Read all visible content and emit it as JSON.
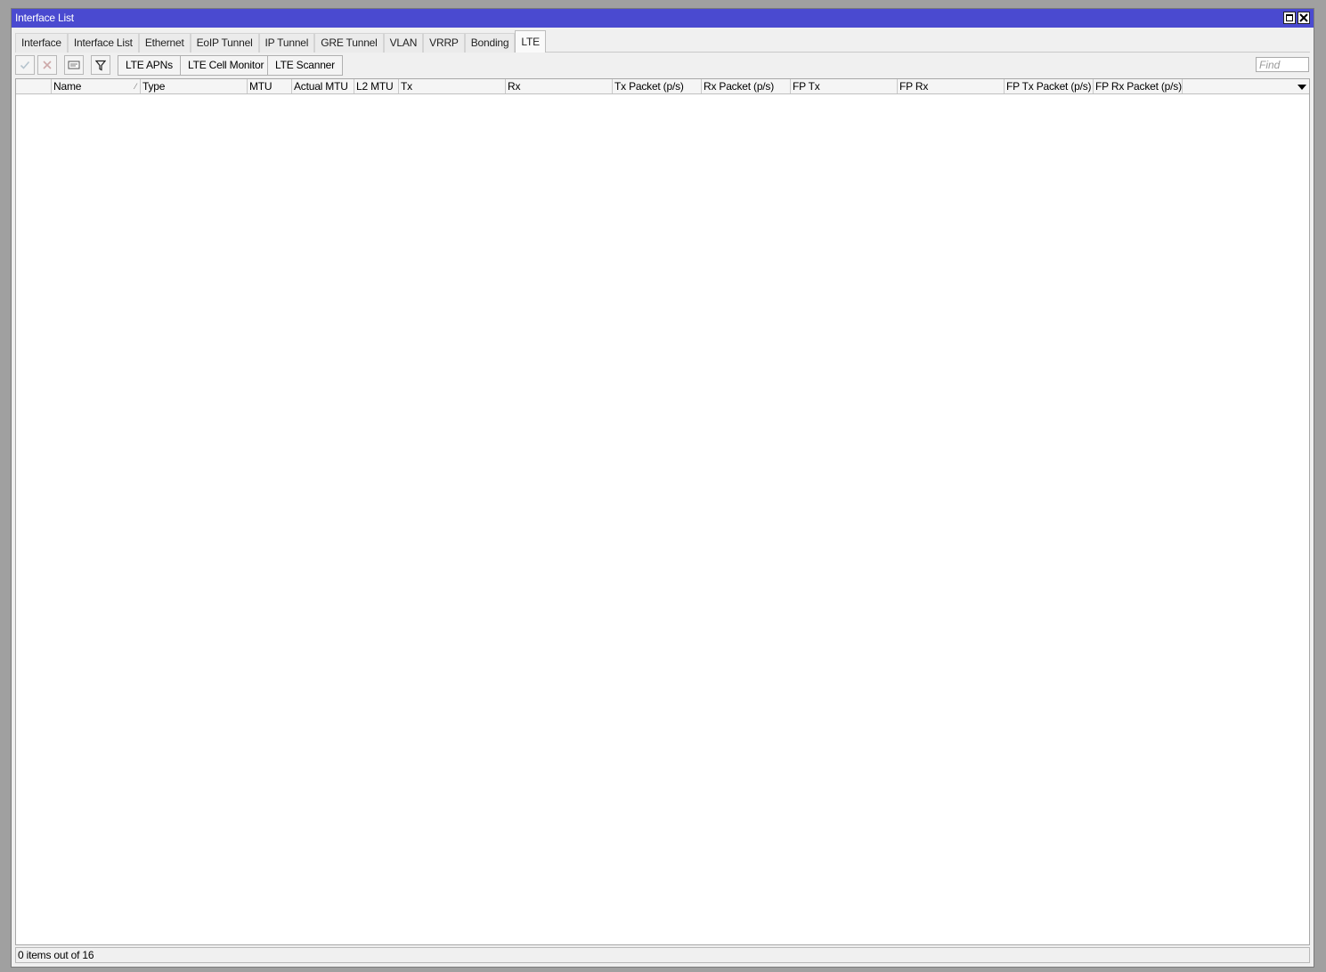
{
  "window": {
    "title": "Interface List"
  },
  "tabs": [
    {
      "label": "Interface"
    },
    {
      "label": "Interface List"
    },
    {
      "label": "Ethernet"
    },
    {
      "label": "EoIP Tunnel"
    },
    {
      "label": "IP Tunnel"
    },
    {
      "label": "GRE Tunnel"
    },
    {
      "label": "VLAN"
    },
    {
      "label": "VRRP"
    },
    {
      "label": "Bonding"
    },
    {
      "label": "LTE",
      "active": true
    }
  ],
  "toolbar": {
    "enable_icon": "check-icon",
    "disable_icon": "cross-icon",
    "comment_icon": "comment-icon",
    "filter_icon": "filter-icon",
    "buttons": [
      "LTE APNs",
      "LTE Cell Monitor",
      "LTE Scanner"
    ],
    "find_placeholder": "Find",
    "find_value": ""
  },
  "table": {
    "columns": [
      "",
      "Name",
      "Type",
      "MTU",
      "Actual MTU",
      "L2 MTU",
      "Tx",
      "Rx",
      "Tx Packet (p/s)",
      "Rx Packet (p/s)",
      "FP Tx",
      "FP Rx",
      "FP Tx Packet (p/s)",
      "FP Rx Packet (p/s)"
    ],
    "sorted_column": "Name",
    "rows": []
  },
  "status": {
    "text": "0 items out of 16"
  },
  "colors": {
    "titlebar": "#4a4ad0",
    "window_bg": "#f0f0f0",
    "desktop_bg": "#a0a0a0"
  }
}
